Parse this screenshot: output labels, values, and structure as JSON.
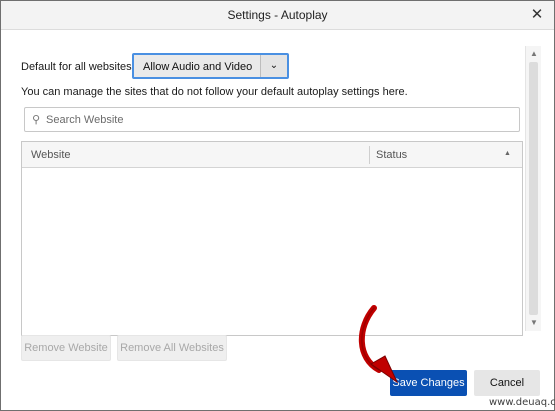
{
  "window": {
    "title": "Settings - Autoplay",
    "close_glyph": "✕"
  },
  "default_setting": {
    "label": "Default for all websites:",
    "selected": "Allow Audio and Video",
    "arrow_glyph": "⌄"
  },
  "manage_text": "You can manage the sites that do not follow your default autoplay settings here.",
  "search": {
    "placeholder": "Search Website",
    "icon": "search-icon"
  },
  "table": {
    "columns": [
      "Website",
      "Status"
    ],
    "sort_glyph": "▲",
    "rows": []
  },
  "buttons": {
    "remove_website": "Remove Website",
    "remove_all": "Remove All Websites",
    "save": "Save Changes",
    "cancel": "Cancel"
  },
  "scrollbar": {
    "up_glyph": "▲",
    "down_glyph": "▼"
  },
  "annotation": {
    "arrow_color": "#c00000"
  },
  "watermark": "www.deuaq.com",
  "colors": {
    "accent": "#0a50b3",
    "focus": "#4a90e2"
  }
}
